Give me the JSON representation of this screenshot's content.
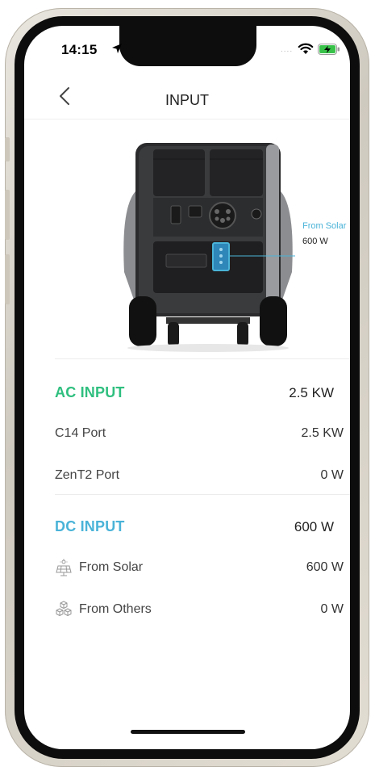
{
  "status_bar": {
    "time": "14:15",
    "signal": "....",
    "location_icon": "location-arrow-icon",
    "wifi_icon": "wifi-icon",
    "battery_icon": "battery-charging-icon"
  },
  "nav": {
    "title": "INPUT",
    "back_icon": "chevron-left-icon"
  },
  "device_callout": {
    "label": "From Solar",
    "value": "600 W"
  },
  "ac_input": {
    "title": "AC INPUT",
    "total": "2.5 KW",
    "color": "#2fbf7f",
    "rows": [
      {
        "label": "C14 Port",
        "value": "2.5 KW"
      },
      {
        "label": "ZenT2 Port",
        "value": "0 W"
      }
    ]
  },
  "dc_input": {
    "title": "DC INPUT",
    "total": "600 W",
    "color": "#4ab3d8",
    "rows": [
      {
        "label": "From Solar",
        "value": "600 W",
        "icon": "solar-panel-icon"
      },
      {
        "label": "From Others",
        "value": "0 W",
        "icon": "cubes-icon"
      }
    ]
  }
}
